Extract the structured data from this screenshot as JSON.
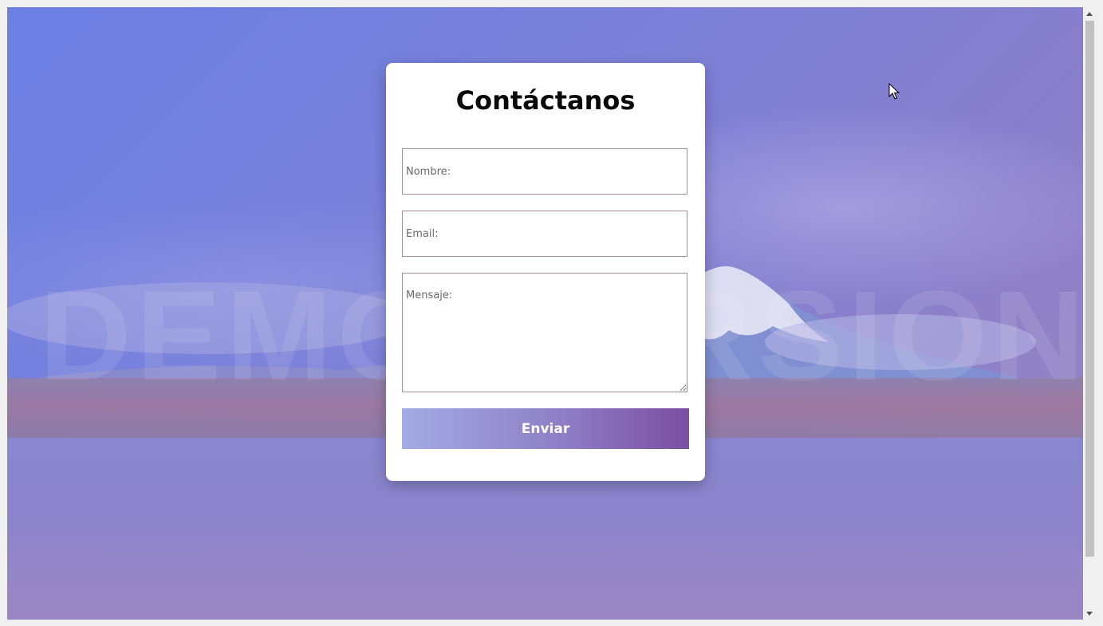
{
  "contact_form": {
    "title": "Contáctanos",
    "name_placeholder": "Nombre:",
    "email_placeholder": "Email:",
    "message_placeholder": "Mensaje:",
    "submit_label": "Enviar"
  },
  "background": {
    "watermark_text": "DEMO VERSION",
    "colors": {
      "sky": "#6b7fe3",
      "button_gradient_start": "#a3abe4",
      "button_gradient_end": "#7a4ea0"
    }
  },
  "icons": {
    "cursor": "mouse-pointer-icon",
    "scroll_up": "chevron-up-icon",
    "scroll_down": "chevron-down-icon"
  }
}
